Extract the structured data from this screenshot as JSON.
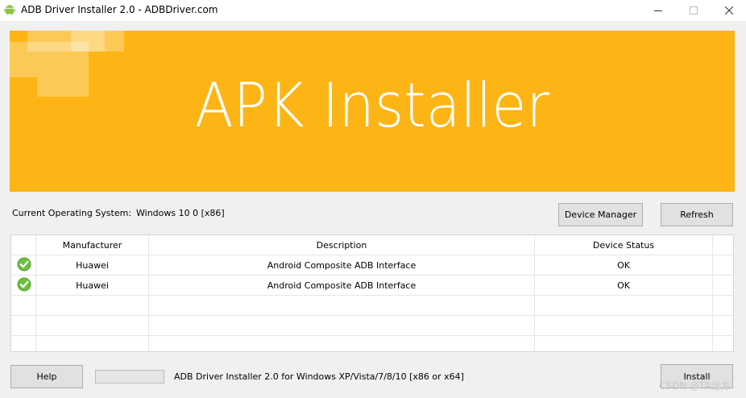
{
  "window": {
    "title": "ADB Driver Installer 2.0 - ADBDriver.com",
    "app_icon": "android-icon",
    "controls": {
      "minimize": "minimize-icon",
      "maximize": "maximize-icon",
      "close": "close-icon"
    }
  },
  "banner": {
    "title": "APK Installer",
    "background": "#fdb515"
  },
  "system": {
    "os_label": "Current Operating System:",
    "os_value": "Windows 10 0 [x86]"
  },
  "buttons": {
    "device_manager": "Device Manager",
    "refresh": "Refresh",
    "help": "Help",
    "install": "Install"
  },
  "table": {
    "columns": [
      "",
      "Manufacturer",
      "Description",
      "Device Status"
    ],
    "rows": [
      {
        "status_icon": "check-icon",
        "manufacturer": "Huawei",
        "description": "Android Composite ADB Interface",
        "status": "OK"
      },
      {
        "status_icon": "check-icon",
        "manufacturer": "Huawei",
        "description": "Android Composite ADB Interface",
        "status": "OK"
      }
    ],
    "empty_rows": 3
  },
  "footer": {
    "progress": 0,
    "info_text": "ADB Driver Installer 2.0 for Windows XP/Vista/7/8/10 [x86 or x64]"
  },
  "watermark": "CSDN @TA远方"
}
